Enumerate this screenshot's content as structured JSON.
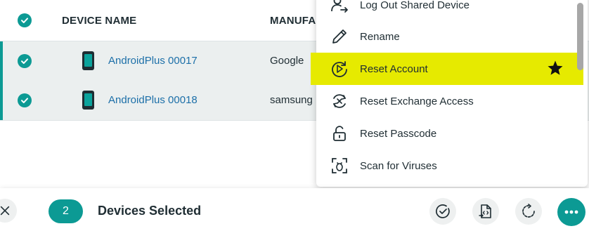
{
  "table": {
    "columns": {
      "device_name": "DEVICE NAME",
      "manufacturer": "MANUFAC"
    },
    "rows": [
      {
        "device_name": "AndroidPlus 00017",
        "manufacturer": "Google"
      },
      {
        "device_name": "AndroidPlus 00018",
        "manufacturer": "samsung"
      }
    ]
  },
  "menu": {
    "items": [
      {
        "label": "Log Out Shared Device",
        "icon": "logout-user-icon"
      },
      {
        "label": "Rename",
        "icon": "pencil-icon"
      },
      {
        "label": "Reset Account",
        "icon": "reset-account-icon",
        "highlighted": true,
        "starred": true
      },
      {
        "label": "Reset Exchange Access",
        "icon": "exchange-reset-icon"
      },
      {
        "label": "Reset Passcode",
        "icon": "unlock-icon"
      },
      {
        "label": "Scan for Viruses",
        "icon": "scan-bug-icon"
      }
    ]
  },
  "bottom_bar": {
    "selected_count": "2",
    "selected_label": "Devices Selected"
  },
  "colors": {
    "accent": "#0c9a94",
    "highlight": "#e6ea00",
    "link": "#1c6fa8",
    "row_selected_bg": "#ebefef"
  }
}
